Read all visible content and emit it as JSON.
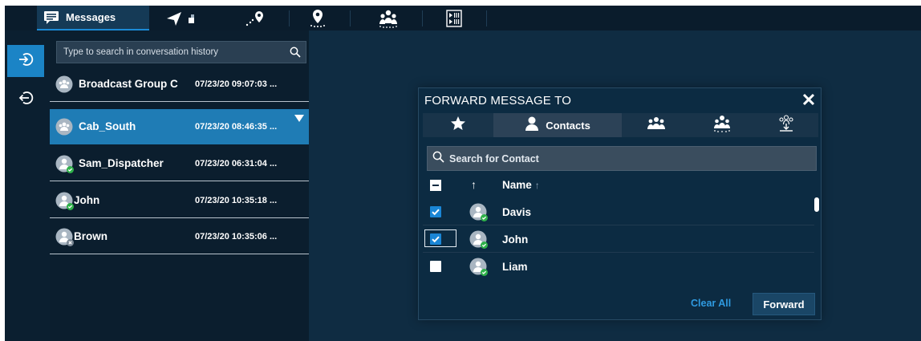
{
  "colors": {
    "app_background": "#0f2c42",
    "topbar": "#0a1c2c",
    "accent": "#1b84c6",
    "selected_row": "#1f7cb5",
    "status_online": "#2fb14a",
    "status_offline": "#7a8794",
    "link": "#2f9ae0"
  },
  "topbar": {
    "tabs": [
      {
        "label": "Messages",
        "icon": "message-icon",
        "active": true
      },
      {
        "icon": "location-arrow-icon",
        "active": false
      },
      {
        "icon": "map-pin-trail-icon",
        "active": false
      },
      {
        "icon": "person-pin-icon",
        "active": false
      },
      {
        "icon": "group-broadcast-icon",
        "active": false
      },
      {
        "icon": "media-player-icon",
        "active": false
      }
    ]
  },
  "rail": {
    "buttons": [
      {
        "icon": "sign-in-icon",
        "active": true
      },
      {
        "icon": "sign-out-icon",
        "active": false
      }
    ]
  },
  "conversation_list": {
    "search_placeholder": "Type to search in conversation history",
    "items": [
      {
        "name": "Broadcast Group C",
        "time": "07/23/20 09:07:03 ...",
        "avatar": "group-avatar-icon",
        "status": "none",
        "selected": false
      },
      {
        "name": "Cab_South",
        "time": "07/23/20 08:46:35 ...",
        "avatar": "group-avatar-icon",
        "status": "none",
        "selected": true
      },
      {
        "name": "Sam_Dispatcher",
        "time": "07/23/20 06:31:04 ...",
        "avatar": "user-avatar-icon",
        "status": "online",
        "selected": false
      },
      {
        "name": "John",
        "time": "07/23/20 10:35:18 ...",
        "avatar": "user-avatar-icon",
        "status": "online",
        "selected": false
      },
      {
        "name": "Brown",
        "time": "07/23/20 10:35:06 ...",
        "avatar": "user-avatar-icon",
        "status": "offline",
        "selected": false
      }
    ]
  },
  "dialog": {
    "title": "FORWARD MESSAGE TO",
    "tabs": [
      {
        "icon": "star-icon",
        "active": false
      },
      {
        "label": "Contacts",
        "icon": "contact-icon",
        "active": true
      },
      {
        "icon": "users-group-icon",
        "active": false
      },
      {
        "icon": "broadcast-group-icon",
        "active": false
      },
      {
        "icon": "download-group-icon",
        "active": false
      }
    ],
    "search_placeholder": "Search for Contact",
    "header": {
      "sort_glyph": "↑",
      "name_label": "Name",
      "name_sort_glyph": "↑"
    },
    "contacts": [
      {
        "name": "Davis",
        "checked": true,
        "status": "online",
        "focused": false
      },
      {
        "name": "John",
        "checked": true,
        "status": "online",
        "focused": true
      },
      {
        "name": "Liam",
        "checked": false,
        "status": "online",
        "focused": false
      }
    ],
    "clear_all_label": "Clear All",
    "forward_label": "Forward"
  }
}
